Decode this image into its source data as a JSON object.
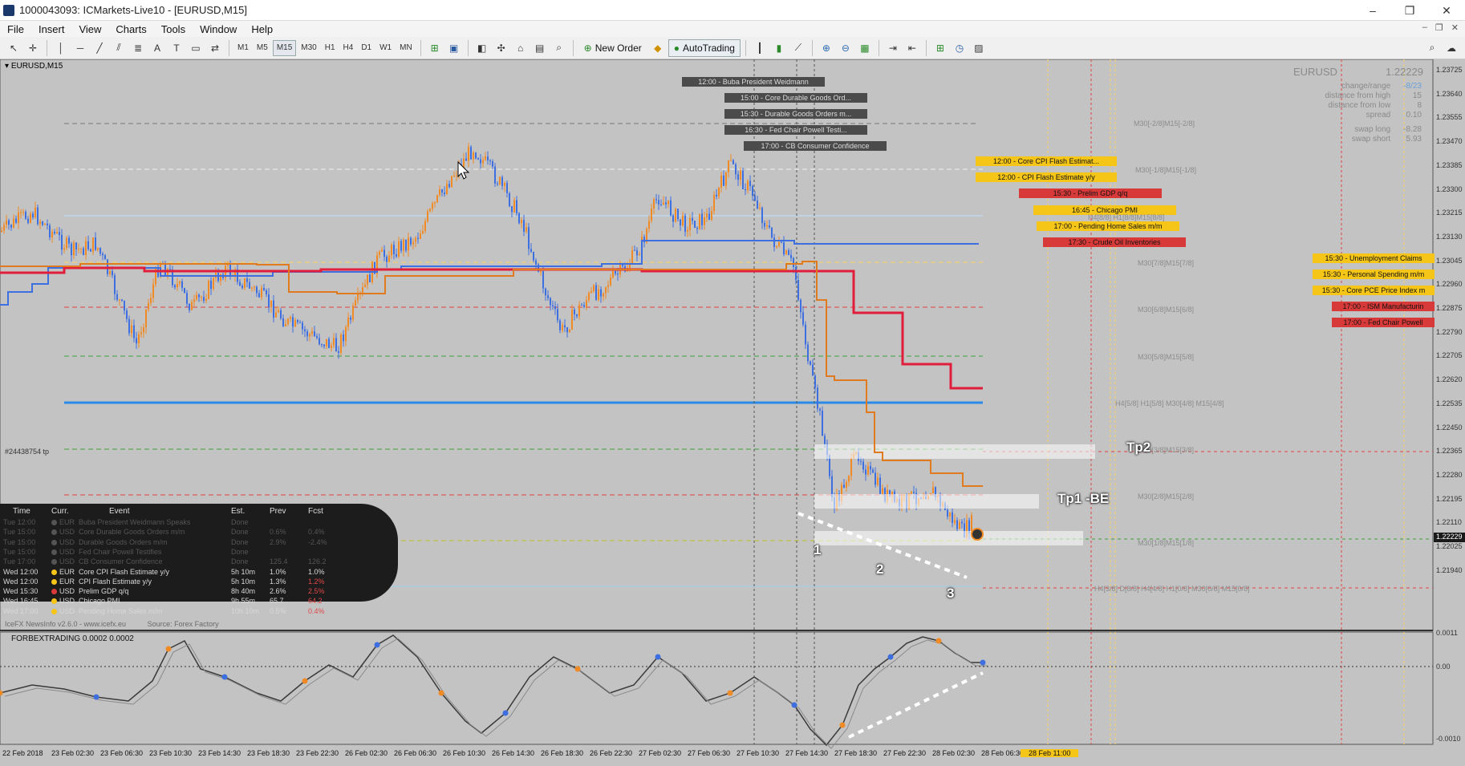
{
  "window": {
    "title": "1000043093: ICMarkets-Live10 - [EURUSD,M15]",
    "buttons": [
      "–",
      "❐",
      "✕"
    ]
  },
  "menu": [
    "File",
    "Insert",
    "View",
    "Charts",
    "Tools",
    "Window",
    "Help"
  ],
  "toolbar": {
    "timeframes": [
      "M1",
      "M5",
      "M15",
      "M30",
      "H1",
      "H4",
      "D1",
      "W1",
      "MN"
    ],
    "active_timeframe": "M15",
    "new_order": "New Order",
    "autotrading": "AutoTrading"
  },
  "chart": {
    "symbol_label": "EURUSD,M15",
    "trade_label": "#24438754 tp",
    "price_panel": {
      "symbol": "EURUSD",
      "bid": "1.22229",
      "rows": [
        {
          "label": "change/range",
          "value": "-8/23"
        },
        {
          "label": "distance from high",
          "value": "15"
        },
        {
          "label": "distance from low",
          "value": "8"
        },
        {
          "label": "spread",
          "value": "0.10"
        },
        {
          "label": "swap long",
          "value": "-8.28"
        },
        {
          "label": "swap short",
          "value": "5.93"
        }
      ]
    },
    "price_axis": [
      "1.23725",
      "1.23640",
      "1.23555",
      "1.23470",
      "1.23385",
      "1.23300",
      "1.23215",
      "1.23130",
      "1.23045",
      "1.22960",
      "1.22875",
      "1.22790",
      "1.22705",
      "1.22620",
      "1.22535",
      "1.22450",
      "1.22365",
      "1.22280",
      "1.22195",
      "1.22110",
      "1.22025",
      "1.21940"
    ],
    "current_price": "1.22229",
    "time_axis": [
      "22 Feb 2018",
      "23 Feb 02:30",
      "23 Feb 06:30",
      "23 Feb 10:30",
      "23 Feb 14:30",
      "23 Feb 18:30",
      "23 Feb 22:30",
      "26 Feb 02:30",
      "26 Feb 06:30",
      "26 Feb 10:30",
      "26 Feb 14:30",
      "26 Feb 18:30",
      "26 Feb 22:30",
      "27 Feb 02:30",
      "27 Feb 06:30",
      "27 Feb 10:30",
      "27 Feb 14:30",
      "27 Feb 18:30",
      "27 Feb 22:30",
      "28 Feb 02:30",
      "28 Feb 06:30"
    ],
    "time_highlight": "28 Feb 11:00",
    "news_bars_dark": [
      "12:00 - Buba President Weidmann",
      "15:00 - Core Durable Goods Ord...",
      "15:30 - Durable Goods Orders m...",
      "16:30 - Fed Chair Powell Testi...",
      "17:00 - CB Consumer Confidence"
    ],
    "news_bars_right": [
      {
        "text": "12:00 - Core CPI Flash Estimat...",
        "color": "yellow"
      },
      {
        "text": "12:00 - CPI Flash Estimate y/y",
        "color": "yellow"
      },
      {
        "text": "15:30 - Prelim GDP q/q",
        "color": "red"
      },
      {
        "text": "16:45 - Chicago PMI",
        "color": "yellow"
      },
      {
        "text": "17:00 - Pending Home Sales m/m",
        "color": "yellow"
      },
      {
        "text": "17:30 - Crude Oil Inventories",
        "color": "red"
      }
    ],
    "news_bars_far": [
      {
        "text": "15:30 - Unemployment Claims",
        "color": "yellow"
      },
      {
        "text": "15:30 - Personal Spending m/m",
        "color": "yellow"
      },
      {
        "text": "15:30 - Core PCE Price Index m",
        "color": "yellow"
      },
      {
        "text": "17:00 - ISM Manufacturin",
        "color": "red"
      },
      {
        "text": "17:00 - Fed Chair Powell",
        "color": "red"
      }
    ],
    "murrey_labels": [
      "M30[-2/8]M15[-2/8]",
      "M30[-1/8]M15[-1/8]",
      "H4[8/8] H1[8/8]M15[8/8]",
      "M30[7/8]M15[7/8]",
      "M30[6/8]M15[6/8]",
      "M30[5/8]M15[5/8]",
      "H4[5/8] H1[5/8] M30[4/8] M15[4/8]",
      "M30[3/8]M15[3/8]",
      "M30[2/8]M15[2/8]",
      "M30[1/8]M15[1/8]",
      "H4[3/8] D[8/8] H4[4/8] H1[0/8] M30[0/8] M15[0/8]"
    ],
    "annotations": {
      "tp2": "Tp2",
      "tp1": "Tp1 -BE",
      "wave1": "1",
      "wave2": "2",
      "wave3": "3"
    }
  },
  "news_panel": {
    "headers": [
      "Time",
      "Curr.",
      "Event",
      "Est.",
      "Prev",
      "Fcst"
    ],
    "rows": [
      {
        "time": "Tue 12:00",
        "curr": "EUR",
        "event": "Buba President Weidmann Speaks",
        "est": "Done",
        "prev": "",
        "fcst": "",
        "dot": "#555555",
        "dim": true
      },
      {
        "time": "Tue 15:00",
        "curr": "USD",
        "event": "Core Durable Goods Orders m/m",
        "est": "Done",
        "prev": "0.6%",
        "fcst": "0.4%",
        "dot": "#555555",
        "dim": true
      },
      {
        "time": "Tue 15:00",
        "curr": "USD",
        "event": "Durable Goods Orders m/m",
        "est": "Done",
        "prev": "2.9%",
        "fcst": "-2.4%",
        "dot": "#555555",
        "dim": true
      },
      {
        "time": "Tue 15:00",
        "curr": "USD",
        "event": "Fed Chair Powell Testifies",
        "est": "Done",
        "prev": "",
        "fcst": "",
        "dot": "#555555",
        "dim": true
      },
      {
        "time": "Tue 17:00",
        "curr": "USD",
        "event": "CB Consumer Confidence",
        "est": "Done",
        "prev": "125.4",
        "fcst": "126.2",
        "dot": "#555555",
        "dim": true
      },
      {
        "time": "Wed 12:00",
        "curr": "EUR",
        "event": "Core CPI Flash Estimate y/y",
        "est": "5h 10m",
        "prev": "1.0%",
        "fcst": "1.0%",
        "dot": "#f5c518",
        "dim": false
      },
      {
        "time": "Wed 12:00",
        "curr": "EUR",
        "event": "CPI Flash Estimate y/y",
        "est": "5h 10m",
        "prev": "1.3%",
        "fcst": "1.2%",
        "dot": "#f5c518",
        "dim": false
      },
      {
        "time": "Wed 15:30",
        "curr": "USD",
        "event": "Prelim GDP q/q",
        "est": "8h 40m",
        "prev": "2.6%",
        "fcst": "2.5%",
        "dot": "#d83a3a",
        "dim": false
      },
      {
        "time": "Wed 16:45",
        "curr": "USD",
        "event": "Chicago PMI",
        "est": "9h 55m",
        "prev": "65.7",
        "fcst": "64.2",
        "dot": "#f5c518",
        "dim": false
      },
      {
        "time": "Wed 17:00",
        "curr": "USD",
        "event": "Pending Home Sales m/m",
        "est": "10h 10m",
        "prev": "0.5%",
        "fcst": "0.4%",
        "dot": "#f5c518",
        "dim": false
      }
    ],
    "footer": [
      "IceFX NewsInfo v2.6.0 - www.icefx.eu",
      "Source: Forex Factory"
    ]
  },
  "indicator": {
    "label": "FORBEXTRADING 0.0002 0.0002",
    "axis": [
      "0.0011",
      "0.00",
      "-0.0010"
    ]
  }
}
